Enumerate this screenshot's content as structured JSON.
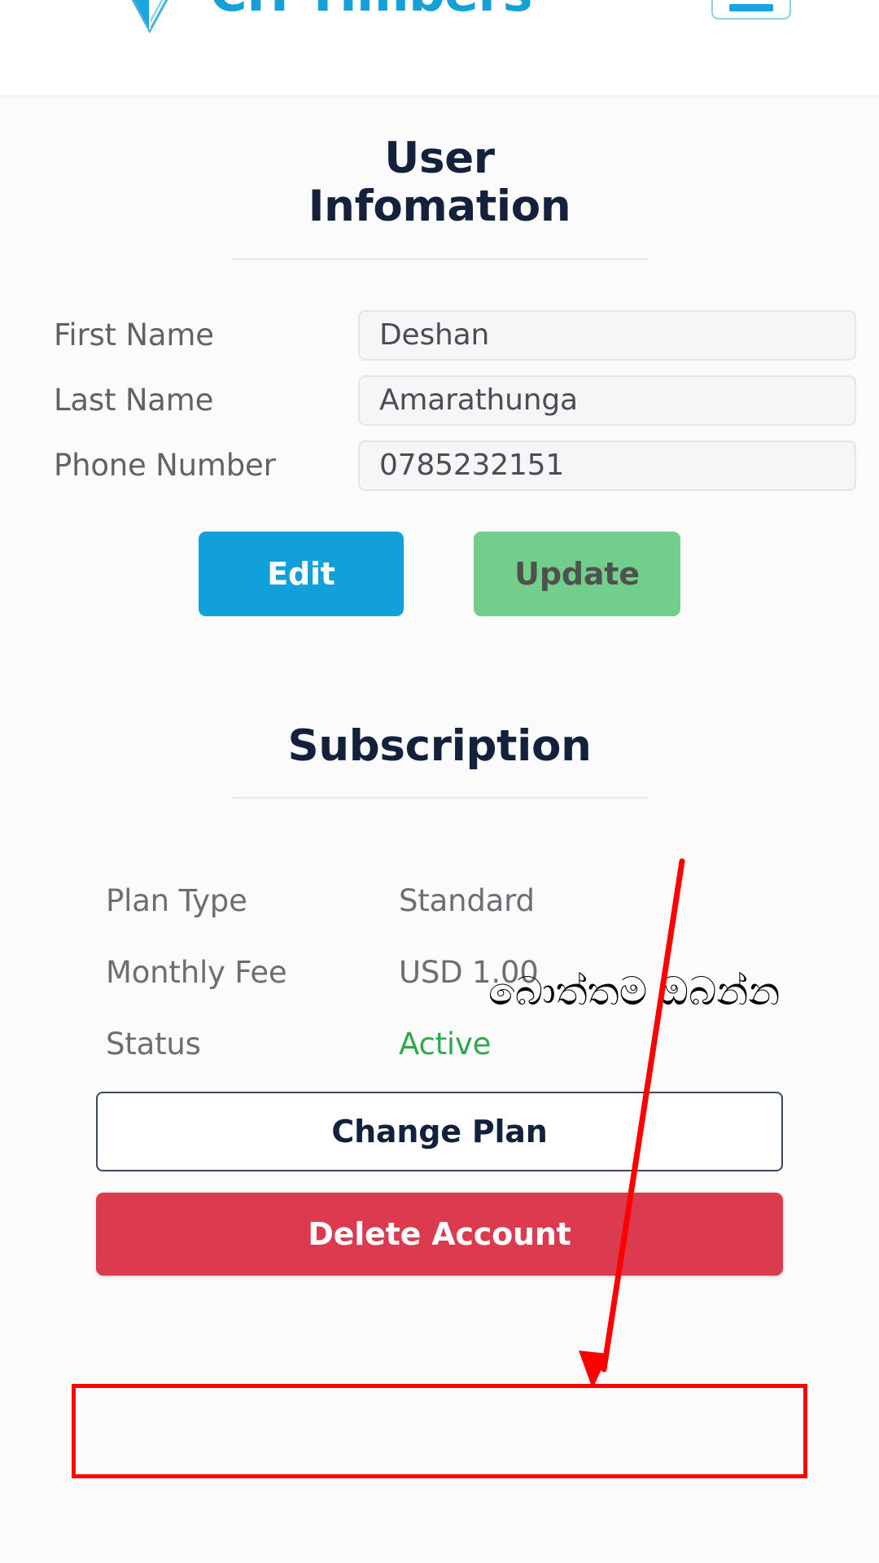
{
  "header": {
    "brand_name": "CH Timbers",
    "logo_icon": "triangular-prism-logo",
    "menu_icon": "hamburger-menu-icon"
  },
  "user_section": {
    "title_line1": "User",
    "title_line2": "Infomation",
    "fields": [
      {
        "label": "First Name",
        "value": "Deshan"
      },
      {
        "label": "Last Name",
        "value": "Amarathunga"
      },
      {
        "label": "Phone Number",
        "value": "0785232151"
      }
    ],
    "buttons": {
      "edit": "Edit",
      "update": "Update"
    }
  },
  "subscription_section": {
    "title": "Subscription",
    "rows": [
      {
        "label": "Plan Type",
        "value": "Standard"
      },
      {
        "label": "Monthly Fee",
        "value": "USD 1.00"
      },
      {
        "label": "Status",
        "value": "Active"
      }
    ],
    "change_plan_label": "Change Plan",
    "delete_account_label": "Delete Account"
  },
  "annotation": {
    "instruction_text": "බොත්තම ඔබන්න",
    "arrow_color": "#ff0000",
    "highlight_color": "#ff0000"
  },
  "colors": {
    "brand_blue": "#16a0d8",
    "heading_navy": "#14213d",
    "edit_blue": "#12a0da",
    "update_green": "#74ce8b",
    "delete_red": "#dc3a4e",
    "status_green": "#2fa84f",
    "page_background": "#fbfbfb"
  }
}
